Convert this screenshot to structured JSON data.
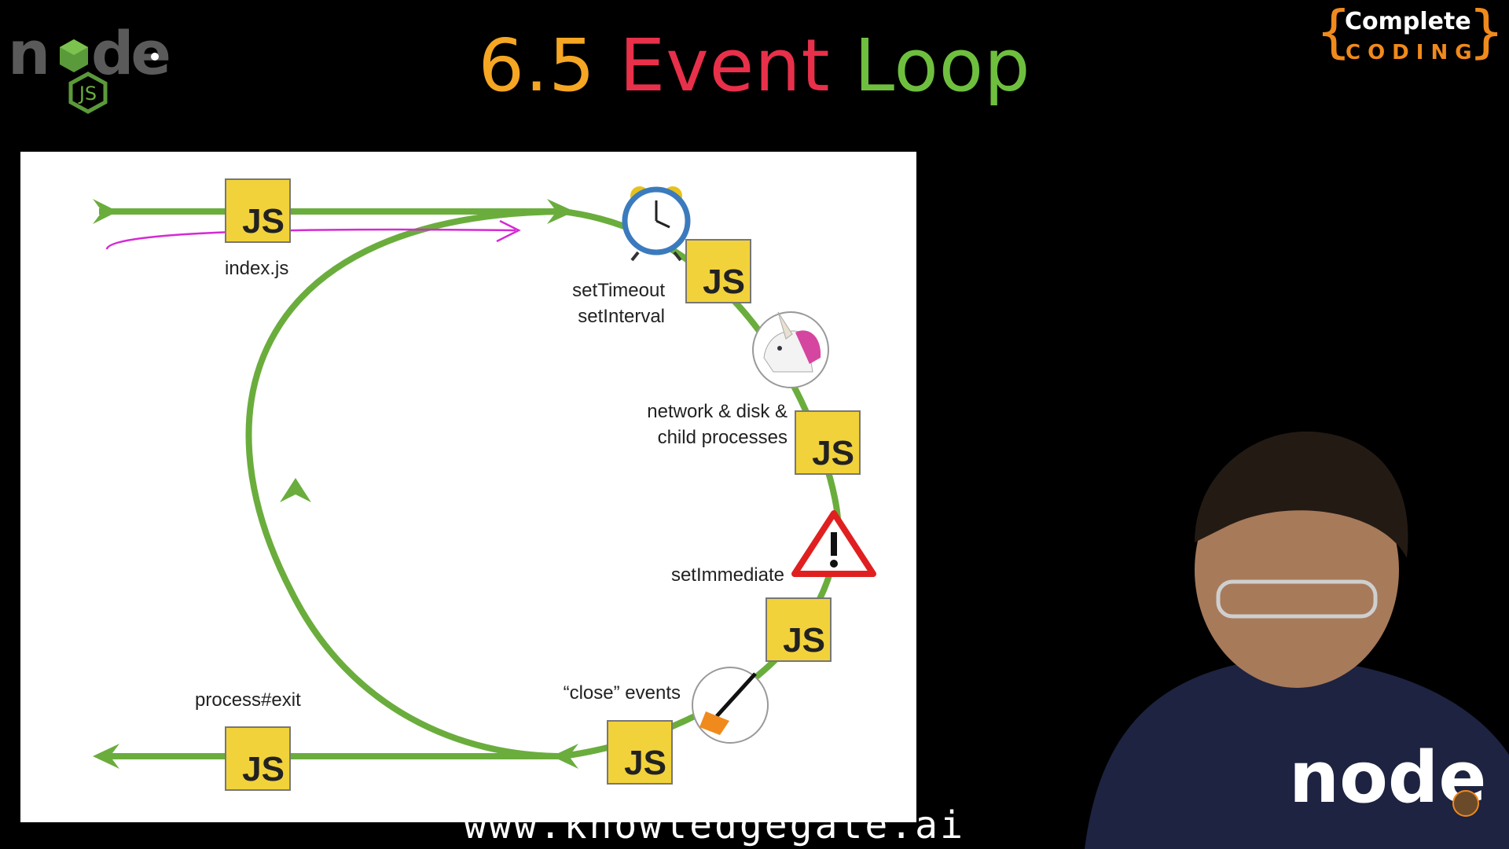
{
  "header": {
    "title_number": "6.5",
    "title_word1": "Event",
    "title_word2": "Loop",
    "node_logo_word": "node",
    "node_logo_sub": "JS",
    "brand_line1": "Complete",
    "brand_line2": "CODING"
  },
  "diagram": {
    "labels": {
      "index": "index.js",
      "timers_1": "setTimeout",
      "timers_2": "setInterval",
      "io_1": "network & disk &",
      "io_2": "child processes",
      "immediate": "setImmediate",
      "close": "“close” events",
      "exit": "process#exit"
    },
    "js_box_text": "JS"
  },
  "footer": {
    "watermark": "www.knowledgegate.ai"
  },
  "colors": {
    "loop_green": "#6aad3d",
    "js_yellow": "#f2d23a",
    "annotation_magenta": "#d42ad4",
    "title_orange": "#f5a623",
    "title_red": "#e8304a",
    "title_green": "#6fbf3f"
  },
  "icons": [
    "node-logo-icon",
    "alarm-clock-icon",
    "unicorn-icon",
    "warning-icon",
    "broom-icon",
    "arrow-icon"
  ]
}
